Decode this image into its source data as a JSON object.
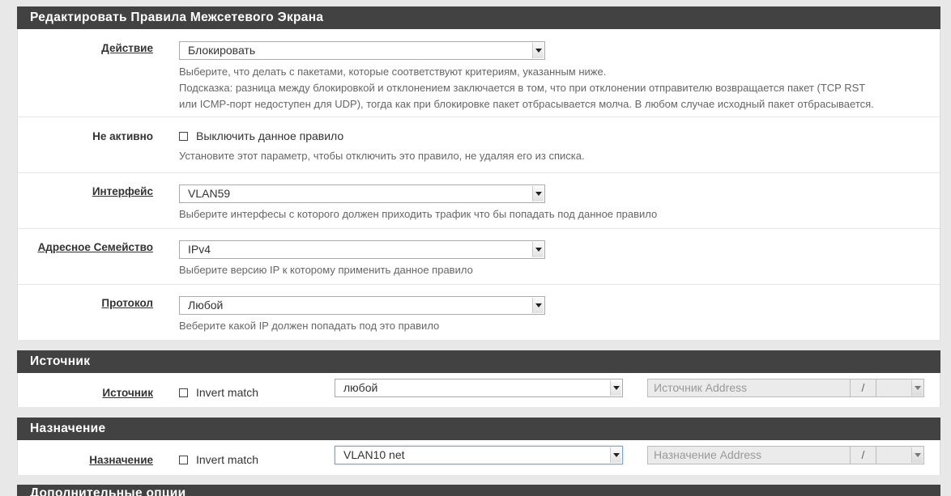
{
  "edit_panel": {
    "title": "Редактировать Правила Межсетевого Экрана",
    "action": {
      "label": "Действие",
      "value": "Блокировать",
      "help1": "Выберите, что делать с пакетами, которые соответствуют критериям, указанным ниже.",
      "help2": "Подсказка: разница между блокировкой и отклонением заключается в том, что при отклонении отправителю возвращается пакет (TCP RST",
      "help3": "или ICMP-порт недоступен для UDP), тогда как при блокировке пакет отбрасывается молча. В любом случае исходный пакет отбрасывается."
    },
    "disabled": {
      "label": "Не активно",
      "checkbox_label": "Выключить данное правило",
      "help": "Установите этот параметр, чтобы отключить это правило, не удаляя его из списка."
    },
    "interface": {
      "label": "Интерфейс",
      "value": "VLAN59",
      "help": "Выберите интерфесы с которого должен приходить трафик что бы попадать под данное правило"
    },
    "family": {
      "label": "Адресное Семейство",
      "value": "IPv4",
      "help": "Выберите версию IP к которому применить данное правило"
    },
    "protocol": {
      "label": "Протокол",
      "value": "Любой",
      "help": "Веберите какой IP должен попадать под это правило"
    }
  },
  "source_panel": {
    "title": "Источник",
    "label": "Источник",
    "invert_label": "Invert match",
    "value": "любой",
    "address_placeholder": "Источник Address",
    "slash": "/"
  },
  "destination_panel": {
    "title": "Назначение",
    "label": "Назначение",
    "invert_label": "Invert match",
    "value": "VLAN10 net",
    "address_placeholder": "Назначение Address",
    "slash": "/"
  },
  "extra_panel": {
    "title": "Дополнительные опции"
  }
}
